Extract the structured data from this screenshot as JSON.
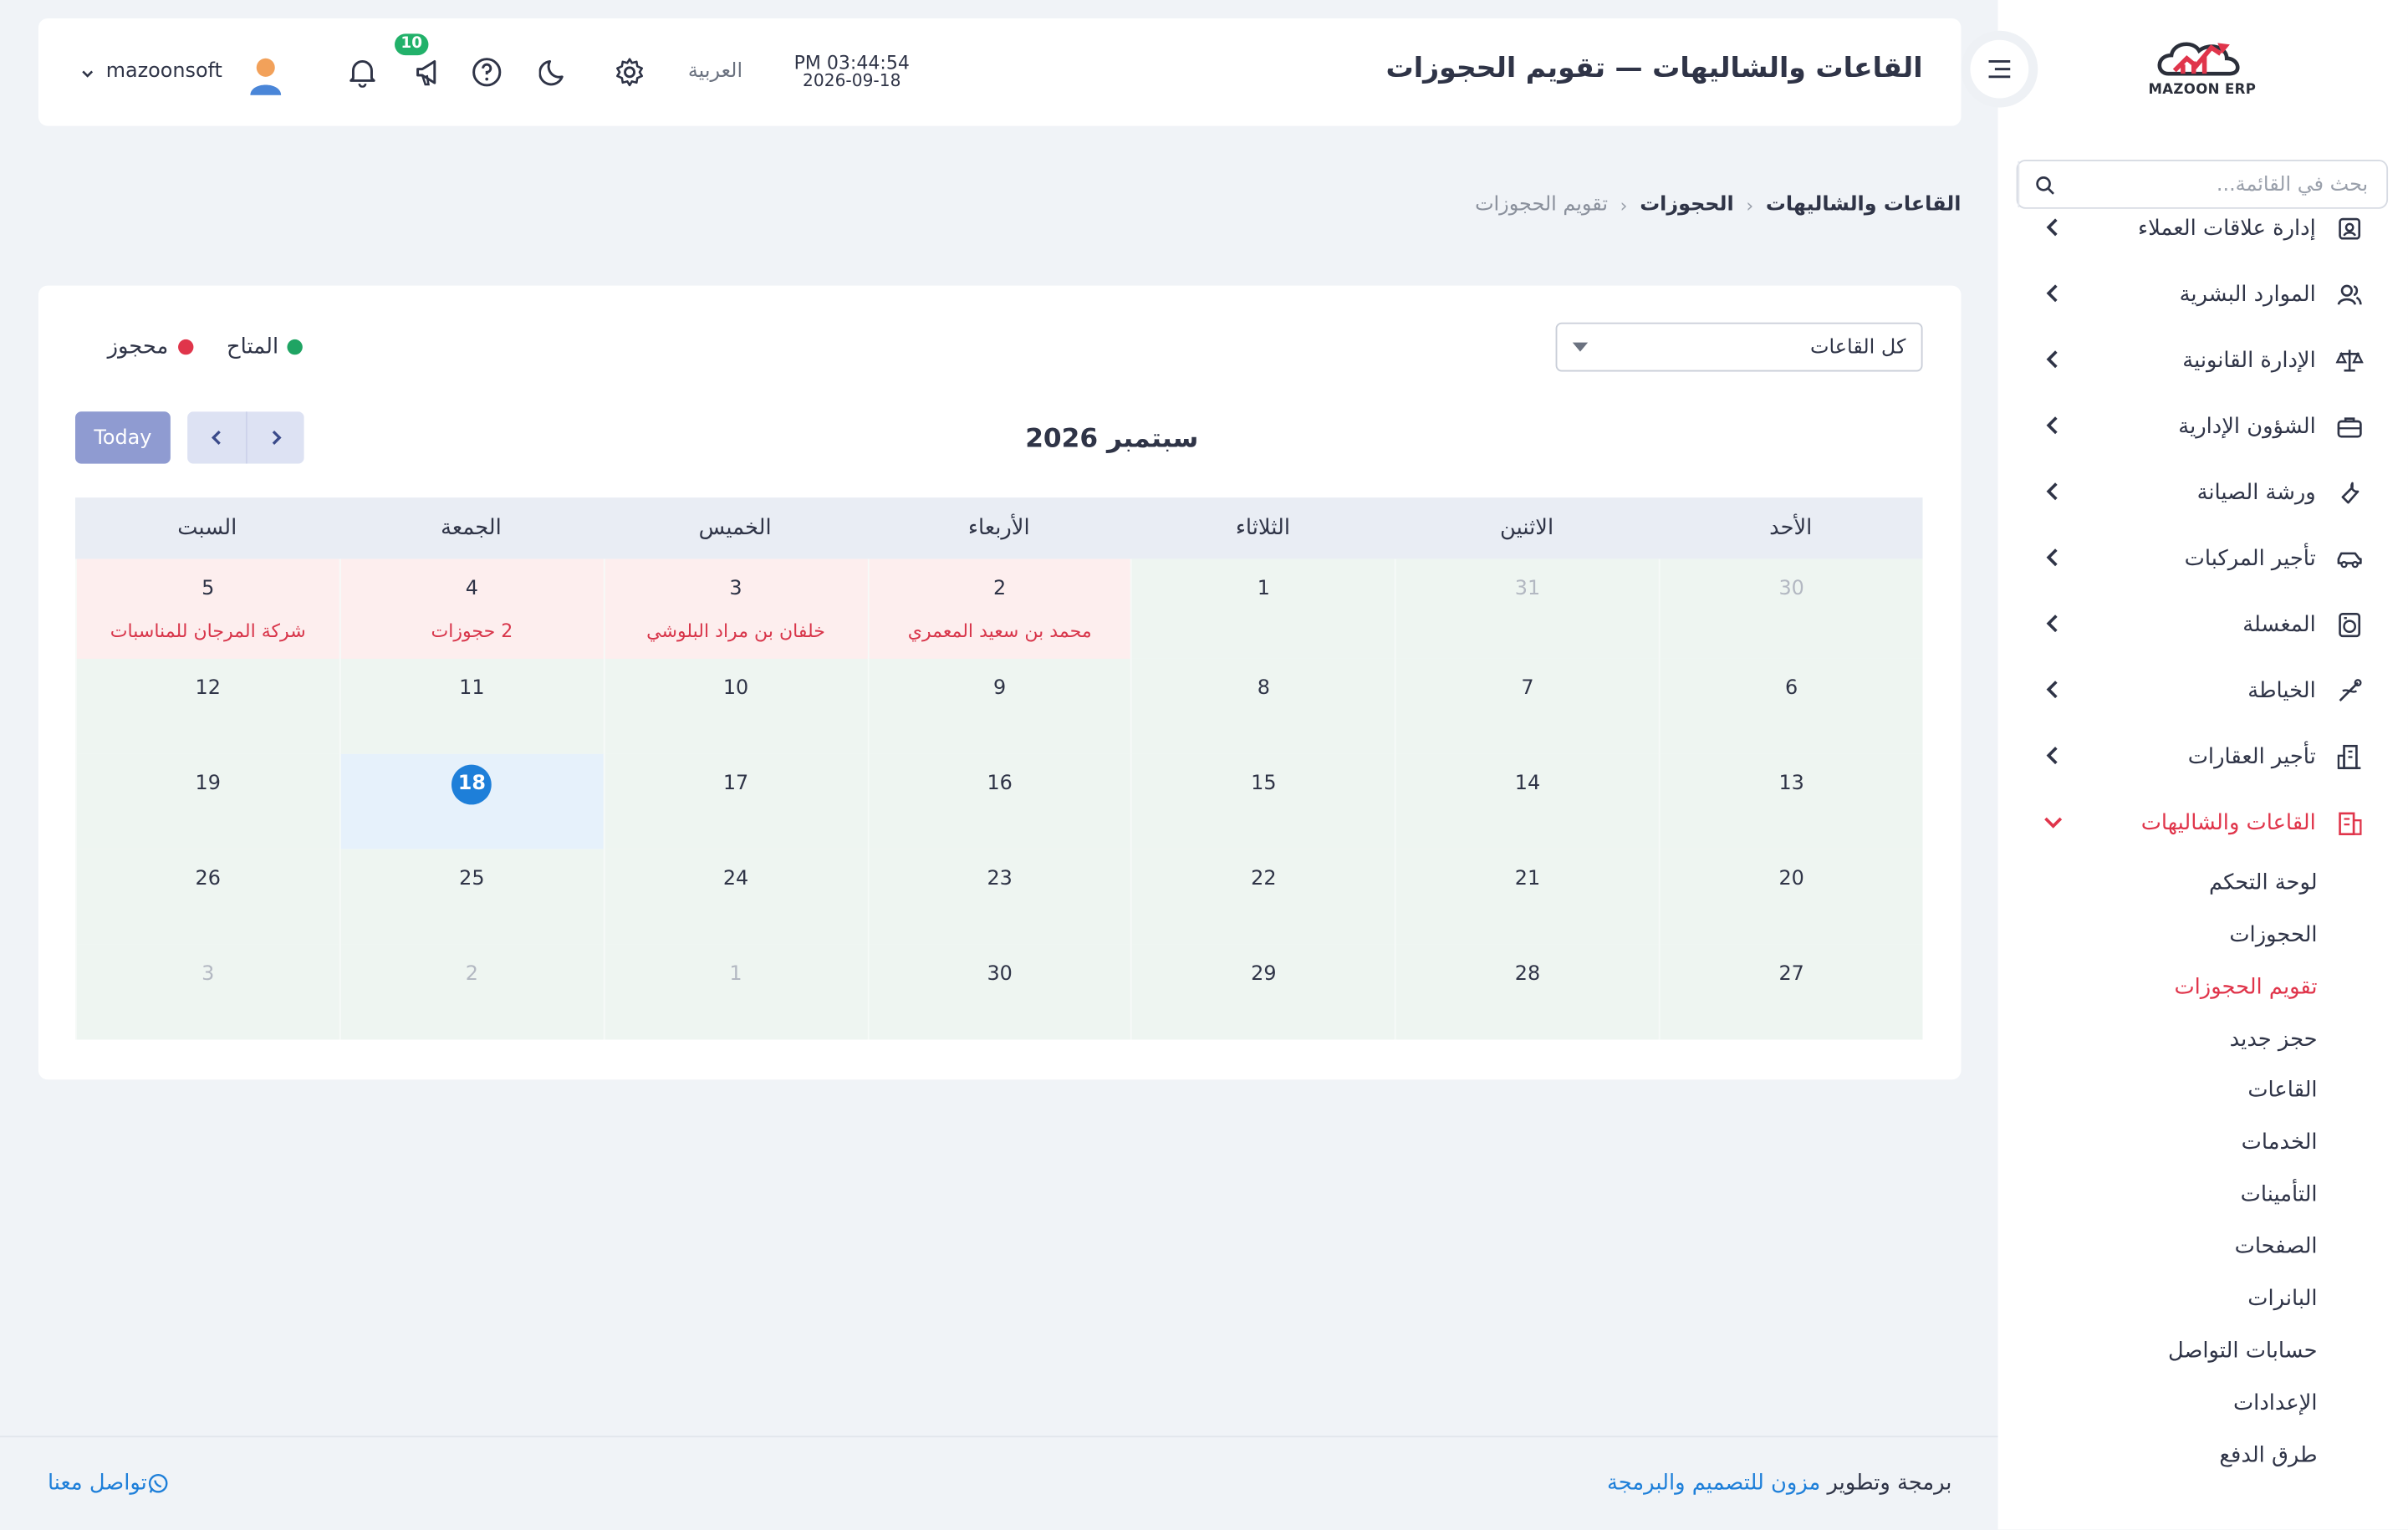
{
  "app": {
    "logo_text": "MAZOON ERP"
  },
  "sidebar": {
    "search_placeholder": "بحث في القائمة...",
    "items": [
      {
        "label": "إدارة علاقات العملاء",
        "icon": "crm-icon"
      },
      {
        "label": "الموارد البشرية",
        "icon": "users-icon"
      },
      {
        "label": "الإدارة القانونية",
        "icon": "scale-icon"
      },
      {
        "label": "الشؤون الإدارية",
        "icon": "briefcase-icon"
      },
      {
        "label": "ورشة الصيانة",
        "icon": "wrench-icon"
      },
      {
        "label": "تأجير المركبات",
        "icon": "car-icon"
      },
      {
        "label": "المغسلة",
        "icon": "laundry-icon"
      },
      {
        "label": "الخياطة",
        "icon": "sewing-icon"
      },
      {
        "label": "تأجير العقارات",
        "icon": "building-icon"
      },
      {
        "label": "القاعات والشاليهات",
        "icon": "hall-icon"
      }
    ],
    "sub_items": [
      "لوحة التحكم",
      "الحجوزات",
      "تقويم الحجوزات",
      "حجز جديد",
      "القاعات",
      "الخدمات",
      "التأمينات",
      "الصفحات",
      "البانرات",
      "حسابات التواصل",
      "الإعدادات",
      "طرق الدفع"
    ]
  },
  "header": {
    "title": "القاعات والشاليهات — تقويم الحجوزات",
    "time": "PM 03:44:54",
    "date": "2026-09-18",
    "language": "العربية",
    "notification_count": "10",
    "username": "mazoonsoft"
  },
  "breadcrumb": [
    "القاعات والشاليهات",
    "الحجوزات",
    "تقويم الحجوزات"
  ],
  "calendar": {
    "hall_select_value": "كل القاعات",
    "legend_available": "المتاح",
    "legend_booked": "محجوز",
    "colors": {
      "available": "#1fa463",
      "booked": "#e0354b",
      "today": "#1e7fd9"
    },
    "today_label": "Today",
    "month_title": "سبتمبر 2026",
    "day_names": [
      "الأحد",
      "الاثنين",
      "الثلاثاء",
      "الأربعاء",
      "الخميس",
      "الجمعة",
      "السبت"
    ],
    "weeks": [
      [
        {
          "day": "30",
          "other": true
        },
        {
          "day": "31",
          "other": true
        },
        {
          "day": "1"
        },
        {
          "day": "2",
          "booked": true,
          "event": "محمد بن سعيد المعمري"
        },
        {
          "day": "3",
          "booked": true,
          "event": "خلفان بن مراد البلوشي"
        },
        {
          "day": "4",
          "booked": true,
          "event": "2 حجوزات"
        },
        {
          "day": "5",
          "booked": true,
          "event": "شركة المرجان للمناسبات"
        }
      ],
      [
        {
          "day": "6"
        },
        {
          "day": "7"
        },
        {
          "day": "8"
        },
        {
          "day": "9"
        },
        {
          "day": "10"
        },
        {
          "day": "11"
        },
        {
          "day": "12"
        }
      ],
      [
        {
          "day": "13"
        },
        {
          "day": "14"
        },
        {
          "day": "15"
        },
        {
          "day": "16"
        },
        {
          "day": "17"
        },
        {
          "day": "18",
          "today": true
        },
        {
          "day": "19"
        }
      ],
      [
        {
          "day": "20"
        },
        {
          "day": "21"
        },
        {
          "day": "22"
        },
        {
          "day": "23"
        },
        {
          "day": "24"
        },
        {
          "day": "25"
        },
        {
          "day": "26"
        }
      ],
      [
        {
          "day": "27"
        },
        {
          "day": "28"
        },
        {
          "day": "29"
        },
        {
          "day": "30"
        },
        {
          "day": "1",
          "other": true
        },
        {
          "day": "2",
          "other": true
        },
        {
          "day": "3",
          "other": true
        }
      ]
    ]
  },
  "footer": {
    "credit_prefix": "برمجة وتطوير",
    "credit_link": "مزون للتصميم والبرمجة",
    "contact": "تواصل معنا"
  }
}
